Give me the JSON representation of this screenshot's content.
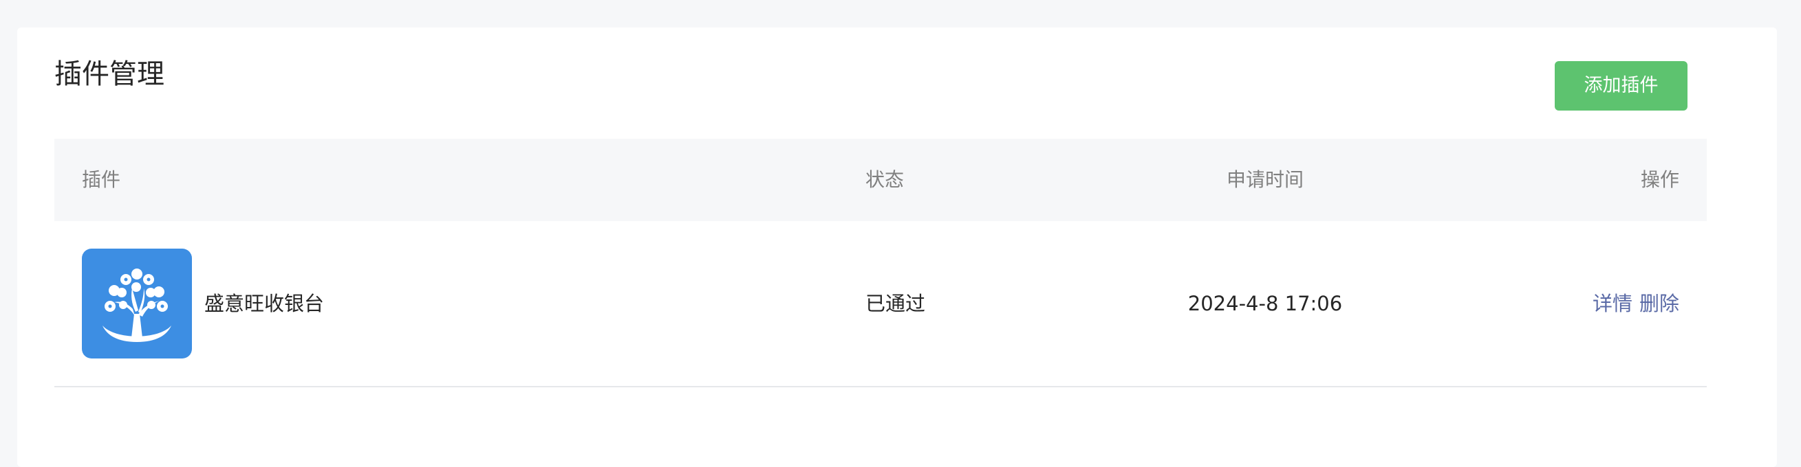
{
  "header": {
    "title": "插件管理",
    "add_button_label": "添加插件"
  },
  "table": {
    "columns": [
      "插件",
      "状态",
      "申请时间",
      "操作"
    ],
    "rows": [
      {
        "icon": "tree-logo-icon",
        "name": "盛意旺收银台",
        "status": "已通过",
        "applied_at": "2024-4-8 17:06",
        "actions": [
          "详情",
          "删除"
        ]
      }
    ]
  },
  "colors": {
    "background": "#f6f7f9",
    "card": "#ffffff",
    "primary_button": "#5dc36f",
    "logo_background": "#3d8ee3",
    "link": "#5a6aa6",
    "header_text": "#808080"
  }
}
